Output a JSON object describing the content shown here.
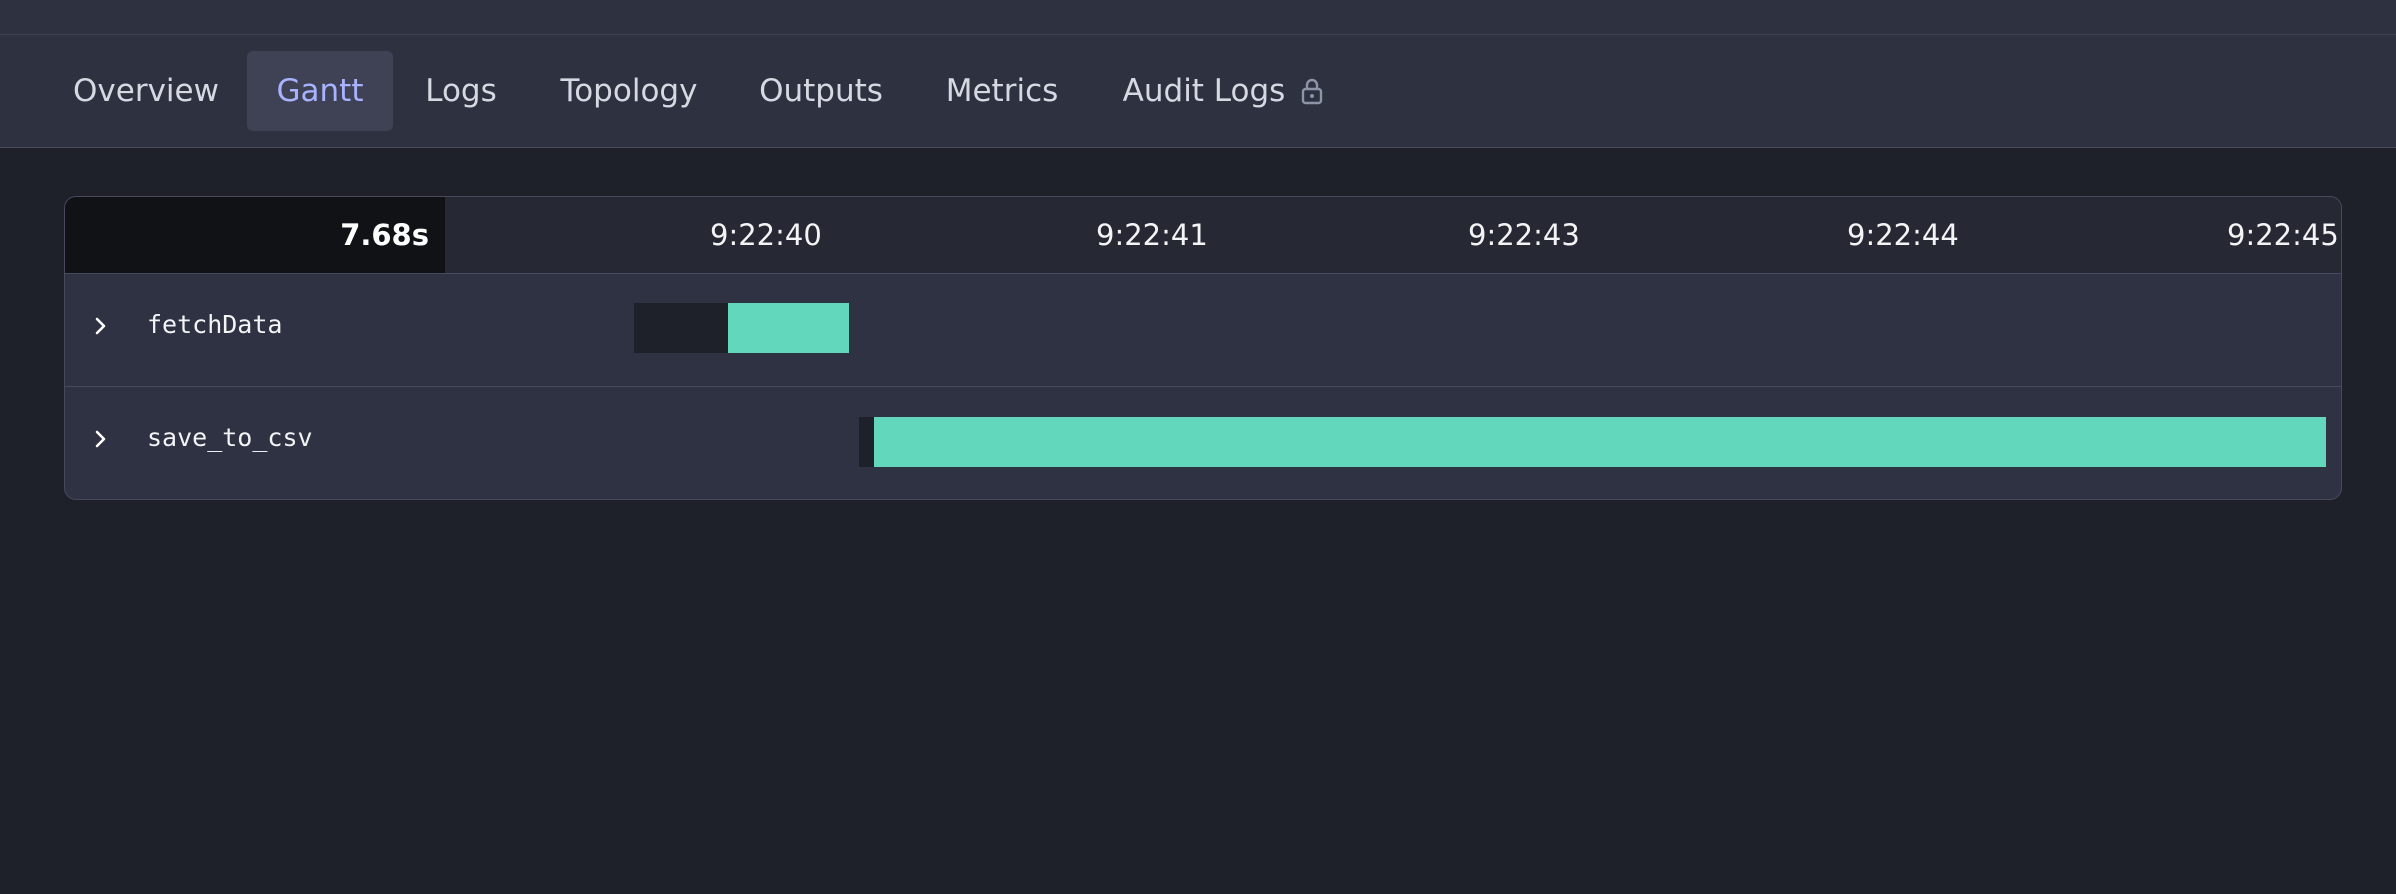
{
  "tabs": [
    {
      "label": "Overview"
    },
    {
      "label": "Gantt",
      "active": true
    },
    {
      "label": "Logs"
    },
    {
      "label": "Topology"
    },
    {
      "label": "Outputs"
    },
    {
      "label": "Metrics"
    },
    {
      "label": "Audit Logs",
      "icon": "lock-icon"
    }
  ],
  "gantt": {
    "total_duration": "7.68s",
    "ticks": [
      "9:22:40",
      "9:22:41",
      "9:22:43",
      "9:22:44",
      "9:22:45"
    ],
    "tasks": [
      {
        "name": "fetchData",
        "expand_icon": "chevron-right-icon"
      },
      {
        "name": "save_to_csv",
        "expand_icon": "chevron-right-icon"
      }
    ]
  },
  "colors": {
    "page_bg": "#1f212a",
    "tabbar_bg": "#2e3140",
    "active_tab_text": "#a8b3ff",
    "run_bar": "#62d7bc",
    "wait_bar": "#1f212a"
  }
}
